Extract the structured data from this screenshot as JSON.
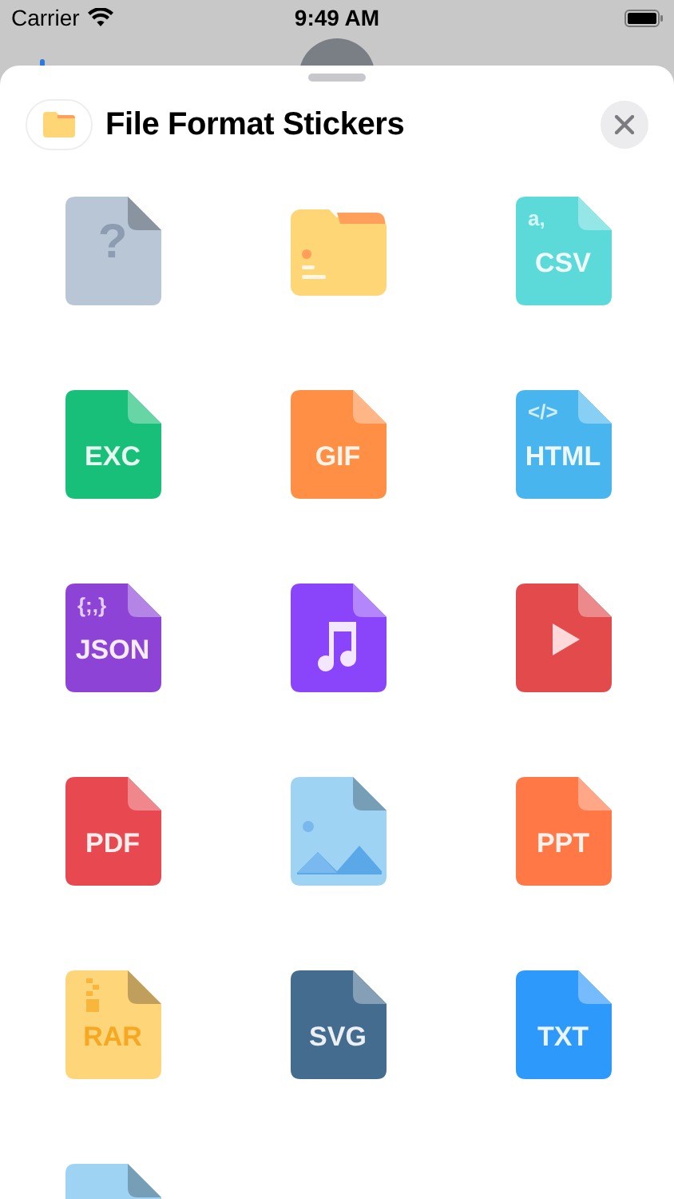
{
  "status_bar": {
    "carrier": "Carrier",
    "time": "9:49 AM"
  },
  "sheet": {
    "title": "File Format Stickers"
  },
  "stickers": [
    {
      "kind": "unknown",
      "label": "?",
      "color": "#b9c6d6"
    },
    {
      "kind": "folder",
      "color": "#ffd676"
    },
    {
      "kind": "file",
      "sublabel": "a,",
      "label": "CSV",
      "color": "#5cd9d9"
    },
    {
      "kind": "file",
      "label": "EXC",
      "color": "#18bf78"
    },
    {
      "kind": "file",
      "label": "GIF",
      "color": "#ff8f45"
    },
    {
      "kind": "file",
      "sublabel": "</>",
      "label": "HTML",
      "color": "#49b5ef"
    },
    {
      "kind": "file",
      "sublabel": "{;,}",
      "label": "JSON",
      "color": "#8d44d6"
    },
    {
      "kind": "music",
      "color": "#8a45fa"
    },
    {
      "kind": "video",
      "color": "#e24a4c"
    },
    {
      "kind": "file",
      "label": "PDF",
      "color": "#e8484f"
    },
    {
      "kind": "image",
      "color": "#9fd3f4"
    },
    {
      "kind": "file",
      "label": "PPT",
      "color": "#ff7845"
    },
    {
      "kind": "zip",
      "label": "RAR",
      "color": "#ffd57a"
    },
    {
      "kind": "file",
      "label": "SVG",
      "color": "#436c8f"
    },
    {
      "kind": "file",
      "label": "TXT",
      "color": "#2d99fa"
    },
    {
      "kind": "blank",
      "color": "#9fd3f4"
    }
  ]
}
